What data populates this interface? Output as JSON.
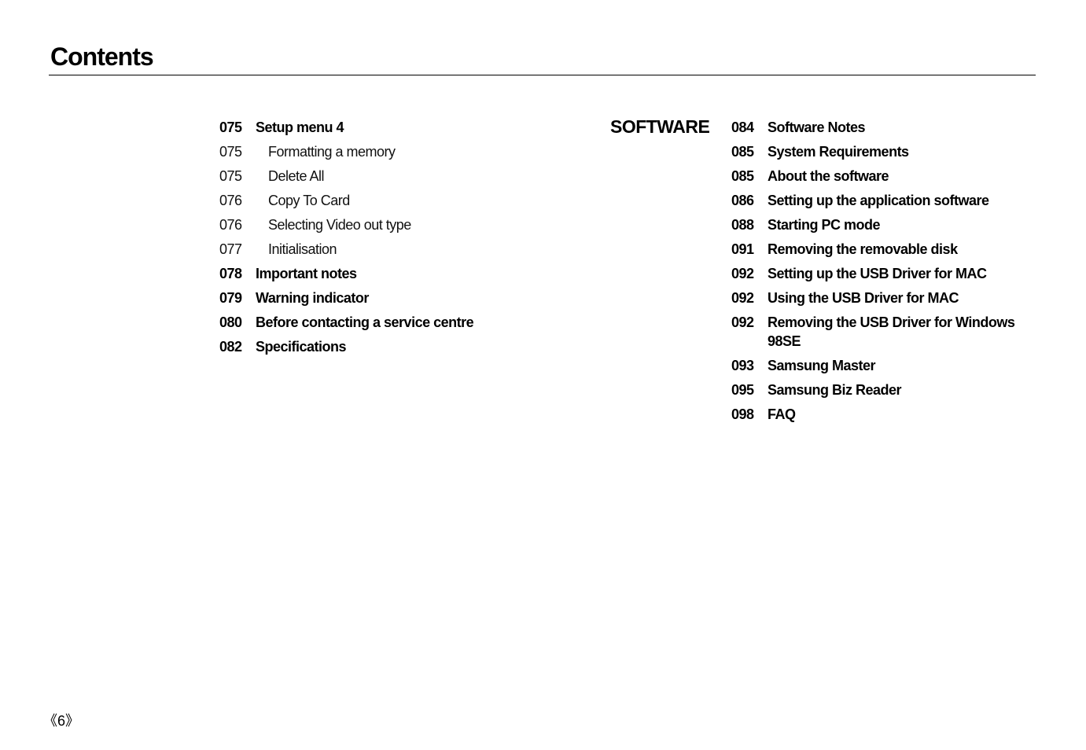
{
  "page": {
    "title": "Contents",
    "page_number": "《6》"
  },
  "left_column": {
    "entries": [
      {
        "page": "075",
        "label": "Setup menu 4",
        "level": "main"
      },
      {
        "page": "075",
        "label": "Formatting a memory",
        "level": "sub"
      },
      {
        "page": "075",
        "label": "Delete All",
        "level": "sub"
      },
      {
        "page": "076",
        "label": "Copy To Card",
        "level": "sub"
      },
      {
        "page": "076",
        "label": "Selecting Video out type",
        "level": "sub"
      },
      {
        "page": "077",
        "label": "Initialisation",
        "level": "sub"
      },
      {
        "page": "078",
        "label": "Important notes",
        "level": "main"
      },
      {
        "page": "079",
        "label": "Warning indicator",
        "level": "main"
      },
      {
        "page": "080",
        "label": "Before contacting a service centre",
        "level": "main"
      },
      {
        "page": "082",
        "label": "Specifications",
        "level": "main"
      }
    ]
  },
  "software_section": {
    "label": "SOFTWARE",
    "entries": [
      {
        "page": "084",
        "label": "Software Notes"
      },
      {
        "page": "085",
        "label": "System Requirements"
      },
      {
        "page": "085",
        "label": "About the software"
      },
      {
        "page": "086",
        "label": "Setting up the application software"
      },
      {
        "page": "088",
        "label": "Starting PC mode"
      },
      {
        "page": "091",
        "label": "Removing the removable disk"
      },
      {
        "page": "092",
        "label": "Setting up the USB Driver for MAC"
      },
      {
        "page": "092",
        "label": "Using the USB Driver for MAC"
      },
      {
        "page": "092",
        "label": "Removing the USB Driver for Windows 98SE"
      },
      {
        "page": "093",
        "label": "Samsung Master"
      },
      {
        "page": "095",
        "label": "Samsung Biz Reader"
      },
      {
        "page": "098",
        "label": "FAQ"
      }
    ]
  }
}
